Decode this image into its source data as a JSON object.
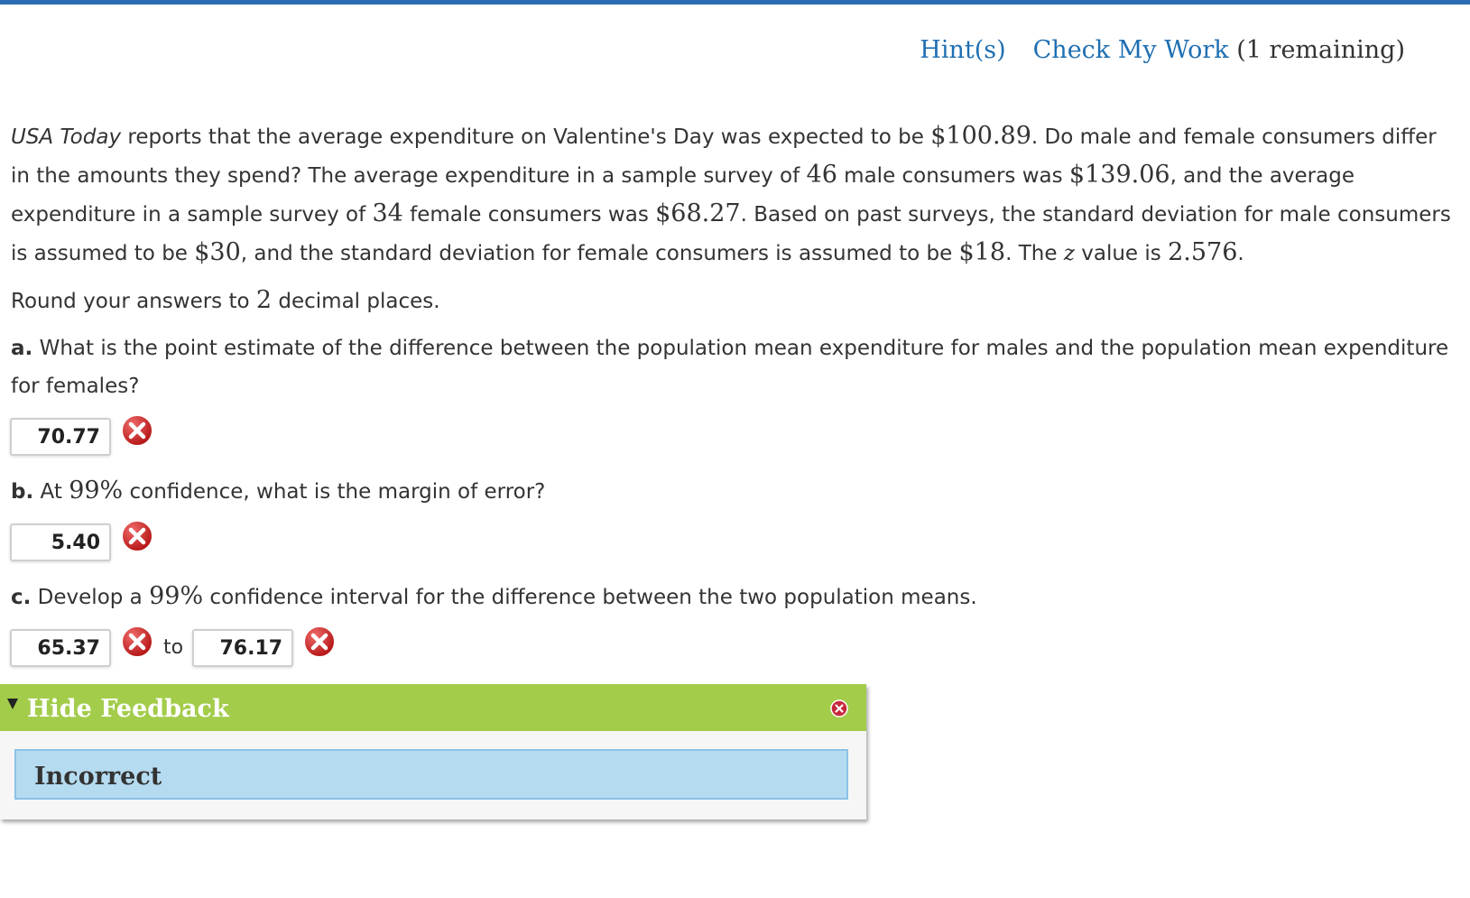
{
  "header": {
    "hint_label": "Hint(s)",
    "check_label": "Check My Work",
    "remaining_label": "(1 remaining)"
  },
  "problem": {
    "source": "USA Today",
    "t1": " reports that the average expenditure on Valentine's Day was expected to be ",
    "n1": "$100.89",
    "t2": ". Do male and female consumers differ in the amounts they spend? The average expenditure in a sample survey of ",
    "n2": "46",
    "t3": " male consumers was ",
    "n3": "$139.06",
    "t4": ", and the average expenditure in a sample survey of ",
    "n4": "34",
    "t5": " female consumers was ",
    "n5": "$68.27",
    "t6": ". Based on past surveys, the standard deviation for male consumers is assumed to be ",
    "n6": "$30",
    "t7": ", and the standard deviation for female consumers is assumed to be ",
    "n7": "$18",
    "t8": ". The ",
    "z": "z",
    "t9": " value is ",
    "n8": "2.576",
    "t10": "."
  },
  "round_note": {
    "pre": "Round your answers to ",
    "num": "2",
    "post": " decimal places."
  },
  "questions": {
    "a": {
      "label": "a.",
      "text": " What is the point estimate of the difference between the population mean expenditure for males and the population mean expenditure for females?",
      "answer": "70.77"
    },
    "b": {
      "label": "b.",
      "pre": " At ",
      "pct": "99%",
      "post": " confidence, what is the margin of error?",
      "answer": "5.40"
    },
    "c": {
      "label": "c.",
      "pre": " Develop a ",
      "pct": "99%",
      "post": " confidence interval for the difference between the two population means.",
      "lower": "65.37",
      "to_label": "to",
      "upper": "76.17"
    }
  },
  "feedback": {
    "title": "Hide Feedback",
    "message": "Incorrect"
  },
  "colors": {
    "link": "#1f6fb2",
    "feedback_header": "#a3cc4b",
    "feedback_body": "#b5dbf0",
    "error_red": "#c81f1f"
  },
  "icons": {
    "answer_status": "incorrect-x-icon",
    "feedback_toggle": "triangle-down-icon",
    "feedback_close": "close-icon"
  }
}
